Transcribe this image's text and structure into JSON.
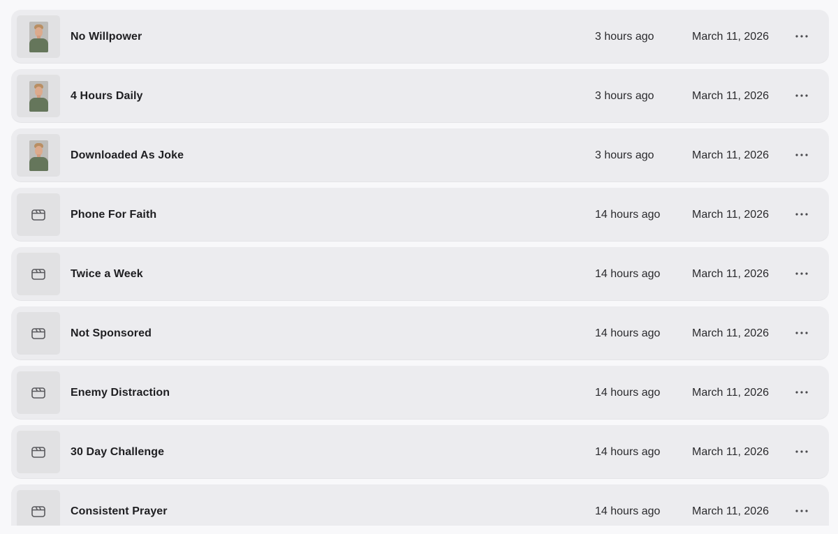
{
  "files": [
    {
      "title": "No Willpower",
      "updated_relative": "3 hours ago",
      "date": "March 11, 2026",
      "thumbnail": "person-photo"
    },
    {
      "title": "4 Hours Daily",
      "updated_relative": "3 hours ago",
      "date": "March 11, 2026",
      "thumbnail": "person-photo"
    },
    {
      "title": "Downloaded As Joke",
      "updated_relative": "3 hours ago",
      "date": "March 11, 2026",
      "thumbnail": "person-photo"
    },
    {
      "title": "Phone For Faith",
      "updated_relative": "14 hours ago",
      "date": "March 11, 2026",
      "thumbnail": "clapperboard-icon"
    },
    {
      "title": "Twice a Week",
      "updated_relative": "14 hours ago",
      "date": "March 11, 2026",
      "thumbnail": "clapperboard-icon"
    },
    {
      "title": "Not Sponsored",
      "updated_relative": "14 hours ago",
      "date": "March 11, 2026",
      "thumbnail": "clapperboard-icon"
    },
    {
      "title": "Enemy Distraction",
      "updated_relative": "14 hours ago",
      "date": "March 11, 2026",
      "thumbnail": "clapperboard-icon"
    },
    {
      "title": "30 Day Challenge",
      "updated_relative": "14 hours ago",
      "date": "March 11, 2026",
      "thumbnail": "clapperboard-icon"
    },
    {
      "title": "Consistent Prayer",
      "updated_relative": "14 hours ago",
      "date": "March 11, 2026",
      "thumbnail": "clapperboard-icon"
    }
  ],
  "row_actions_icon": "more-horizontal-icon",
  "colors": {
    "page_background": "#f8f8fa",
    "row_background": "#ececef",
    "thumbnail_background": "#e1e1e3",
    "text_primary": "#1e1e21",
    "text_secondary": "#2a2a2d"
  }
}
